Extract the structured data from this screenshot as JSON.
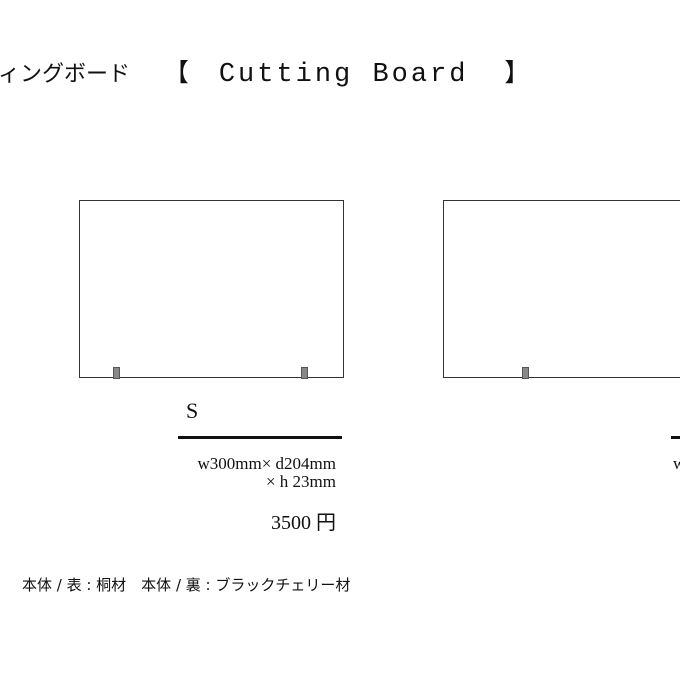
{
  "header": {
    "title_jp": "ィングボード",
    "bracket_open": "【",
    "title_en": "Cutting Board",
    "bracket_close": "】"
  },
  "products": [
    {
      "size": "S",
      "dims_line1": "w300mm× d204mm",
      "dims_line2": "× h  23mm",
      "price": "3500 円"
    },
    {
      "size": "",
      "dims_line1": "w",
      "partial": true
    }
  ],
  "material": "本体 / 表 : 桐材　本体 / 裏 : ブラックチェリー材"
}
